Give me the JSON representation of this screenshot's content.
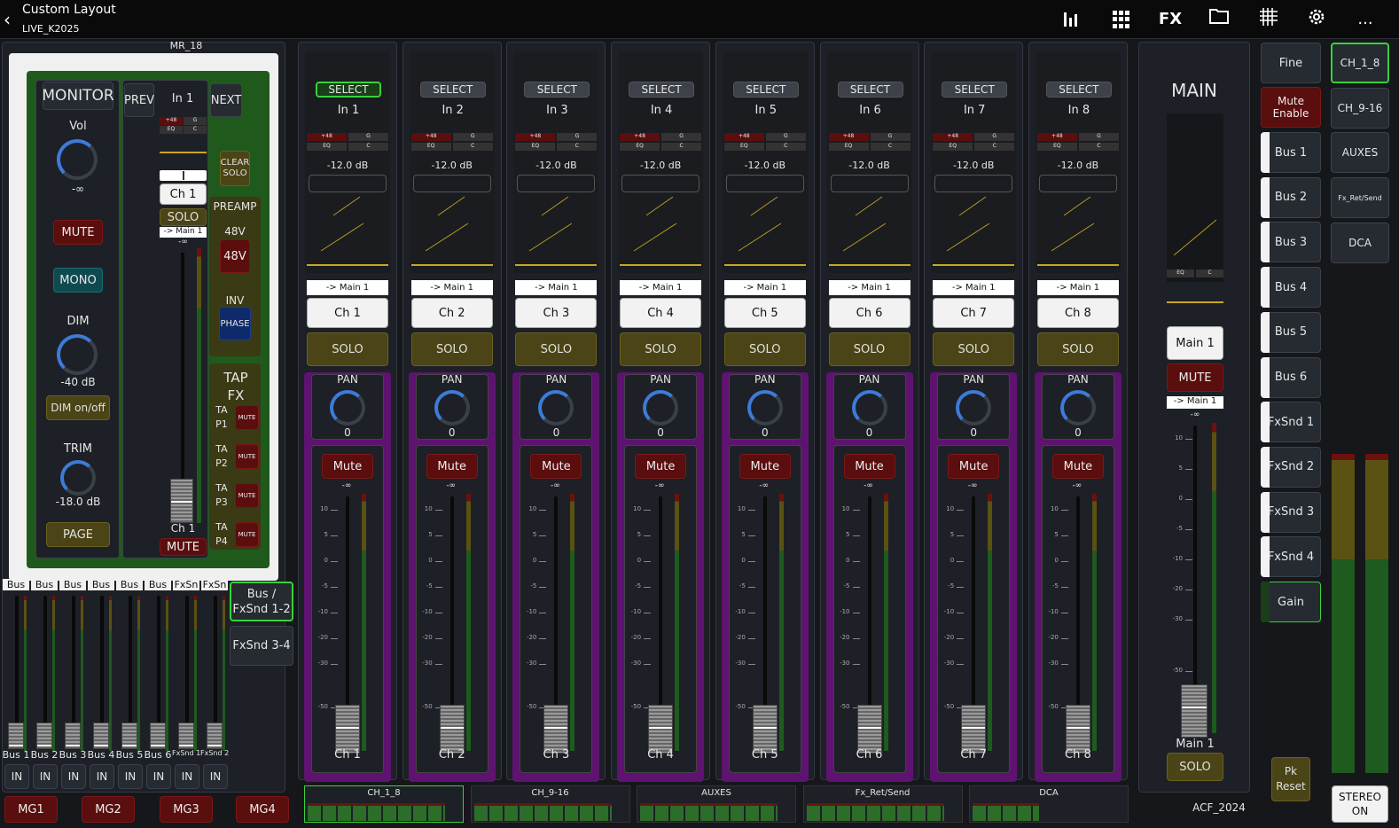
{
  "window": {
    "title": "Custom Layout",
    "subtitle": "LIVE_K2025",
    "back_icon": "back-chevron-icon"
  },
  "toolbar": {
    "fx_label": "FX",
    "more_label": "...",
    "icons": [
      "meters-icon",
      "grid-icon",
      "fx-icon",
      "folder-icon",
      "routing-grid-icon",
      "gear-icon",
      "more-icon"
    ]
  },
  "monitor": {
    "header": "MR_18",
    "title": "MONITOR",
    "vol_label": "Vol",
    "vol_value": "-∞",
    "mute": "MUTE",
    "mono": "MONO",
    "dim_label": "DIM",
    "dim_value": "-40 dB",
    "dim_toggle": "DIM on/off",
    "trim_label": "TRIM",
    "trim_value": "-18.0 dB",
    "page": "PAGE"
  },
  "channel_nav": {
    "prev": "PREV",
    "current": "In 1",
    "next": "NEXT",
    "ch_name": "Ch 1",
    "solo": "SOLO",
    "route": "-> Main 1",
    "ch_label": "Ch 1",
    "mute": "MUTE",
    "gain_top": "-∞"
  },
  "side_controls": {
    "clear_solo": "CLEAR SOLO",
    "preamp": "PREAMP",
    "p48_label": "48V",
    "p48_btn": "48V",
    "inv": "INV",
    "phase": "PHASE",
    "tapfx": "TAP FX",
    "taps": [
      {
        "label": "TA P1",
        "mute": "MUTE"
      },
      {
        "label": "TA P2",
        "mute": "MUTE"
      },
      {
        "label": "TA P3",
        "mute": "MUTE"
      },
      {
        "label": "TA P4",
        "mute": "MUTE"
      }
    ]
  },
  "mini_strips": {
    "tops": [
      "Bus",
      "Bus",
      "Bus",
      "Bus",
      "Bus",
      "Bus",
      "FxSn",
      "FxSn"
    ],
    "bottoms": [
      "Bus 1",
      "Bus 2",
      "Bus 3",
      "Bus 4",
      "Bus 5",
      "Bus 6",
      "FxSnd 1",
      "FxSnd 2"
    ],
    "in": "IN"
  },
  "bus_buttons": {
    "active": "Bus / FxSnd 1-2",
    "other": "FxSnd 3-4"
  },
  "mg": [
    "MG1",
    "MG2",
    "MG3",
    "MG4"
  ],
  "channels": [
    {
      "select": "SELECT",
      "input": "In 1",
      "gain": "-12.0 dB",
      "route": "-> Main 1",
      "name": "Ch 1",
      "solo": "SOLO",
      "pan": "PAN",
      "pan_value": "0",
      "mute": "Mute",
      "fader_top": "-∞",
      "label": "Ch 1",
      "selected": true
    },
    {
      "select": "SELECT",
      "input": "In 2",
      "gain": "-12.0 dB",
      "route": "-> Main 1",
      "name": "Ch 2",
      "solo": "SOLO",
      "pan": "PAN",
      "pan_value": "0",
      "mute": "Mute",
      "fader_top": "-∞",
      "label": "Ch 2",
      "selected": false
    },
    {
      "select": "SELECT",
      "input": "In 3",
      "gain": "-12.0 dB",
      "route": "-> Main 1",
      "name": "Ch 3",
      "solo": "SOLO",
      "pan": "PAN",
      "pan_value": "0",
      "mute": "Mute",
      "fader_top": "-∞",
      "label": "Ch 3",
      "selected": false
    },
    {
      "select": "SELECT",
      "input": "In 4",
      "gain": "-12.0 dB",
      "route": "-> Main 1",
      "name": "Ch 4",
      "solo": "SOLO",
      "pan": "PAN",
      "pan_value": "0",
      "mute": "Mute",
      "fader_top": "-∞",
      "label": "Ch 4",
      "selected": false
    },
    {
      "select": "SELECT",
      "input": "In 5",
      "gain": "-12.0 dB",
      "route": "-> Main 1",
      "name": "Ch 5",
      "solo": "SOLO",
      "pan": "PAN",
      "pan_value": "0",
      "mute": "Mute",
      "fader_top": "-∞",
      "label": "Ch 5",
      "selected": false
    },
    {
      "select": "SELECT",
      "input": "In 6",
      "gain": "-12.0 dB",
      "route": "-> Main 1",
      "name": "Ch 6",
      "solo": "SOLO",
      "pan": "PAN",
      "pan_value": "0",
      "mute": "Mute",
      "fader_top": "-∞",
      "label": "Ch 6",
      "selected": false
    },
    {
      "select": "SELECT",
      "input": "In 7",
      "gain": "-12.0 dB",
      "route": "-> Main 1",
      "name": "Ch 7",
      "solo": "SOLO",
      "pan": "PAN",
      "pan_value": "0",
      "mute": "Mute",
      "fader_top": "-∞",
      "label": "Ch 7",
      "selected": false
    },
    {
      "select": "SELECT",
      "input": "In 8",
      "gain": "-12.0 dB",
      "route": "-> Main 1",
      "name": "Ch 8",
      "solo": "SOLO",
      "pan": "PAN",
      "pan_value": "0",
      "mute": "Mute",
      "fader_top": "-∞",
      "label": "Ch 8",
      "selected": false
    }
  ],
  "strip_tags": {
    "p48": "+48",
    "g": "G",
    "eq": "EQ",
    "c": "C"
  },
  "scale": [
    "10",
    "5",
    "0",
    "-5",
    "-10",
    "-20",
    "-30",
    "-50"
  ],
  "main": {
    "title": "MAIN",
    "eq": "EQ",
    "c": "C",
    "name": "Main 1",
    "mute": "MUTE",
    "route": "-> Main 1",
    "fader_top": "-∞",
    "label": "Main 1",
    "solo": "SOLO"
  },
  "right_column": {
    "fine": "Fine",
    "mute_enable": "Mute Enable",
    "buses": [
      "Bus 1",
      "Bus 2",
      "Bus 3",
      "Bus 4",
      "Bus 5",
      "Bus 6",
      "FxSnd 1",
      "FxSnd 2",
      "FxSnd 3",
      "FxSnd 4",
      "Gain"
    ],
    "pk_reset": "Pk Reset"
  },
  "layers": {
    "items": [
      "CH_1_8",
      "CH_9-16",
      "AUXES",
      "Fx_Ret/Send",
      "DCA"
    ],
    "active": "CH_1_8"
  },
  "footer": {
    "scene": "ACF_2024",
    "stereo": "STEREO ON"
  },
  "colors": {
    "accent_green": "#3ad13a",
    "purple": "#5e1370",
    "solo": "#4a4416",
    "mute": "#5a0e0e",
    "knob_blue": "#3d7bd8"
  }
}
